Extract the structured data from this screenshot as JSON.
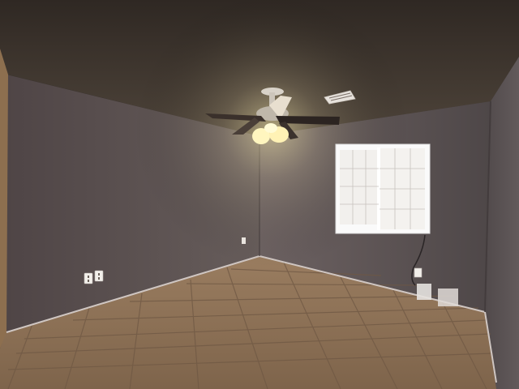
{
  "scene": {
    "subject": "empty room",
    "palette": {
      "ceiling": "#463c34",
      "left_wall": "#5e5452",
      "back_wall": "#5d5556",
      "right_wall": "#595152",
      "floor": "#8e7257",
      "window_glass": "#f4f2ef",
      "window_frame": "#fafafa",
      "light_glow": "#fff3b0"
    }
  }
}
